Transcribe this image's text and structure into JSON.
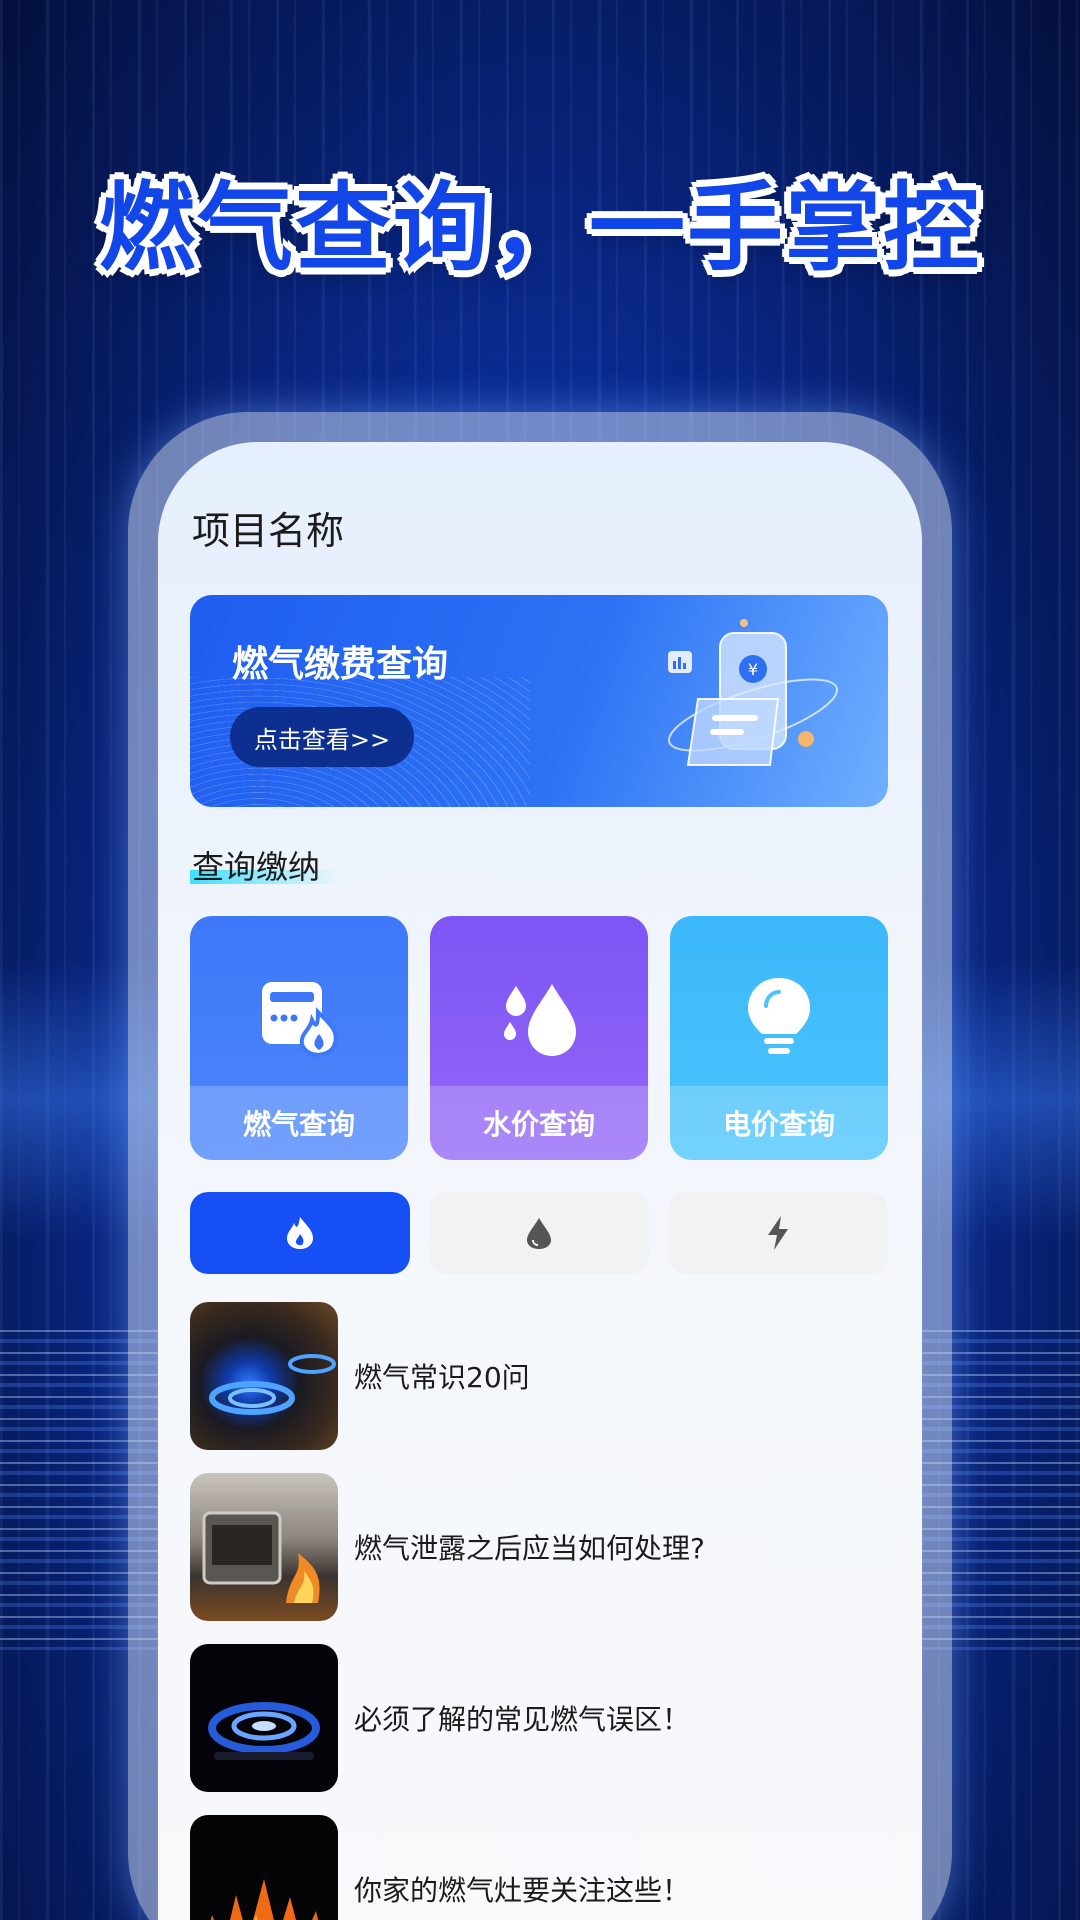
{
  "headline": "燃气查询，一手掌控",
  "app": {
    "project_name": "项目名称"
  },
  "banner": {
    "title": "燃气缴费查询",
    "button_label": "点击查看>>"
  },
  "section": {
    "title": "查询缴纳"
  },
  "tiles": [
    {
      "label": "燃气查询",
      "icon": "gas-meter-icon"
    },
    {
      "label": "水价查询",
      "icon": "water-drops-icon"
    },
    {
      "label": "电价查询",
      "icon": "lightbulb-icon"
    }
  ],
  "tabs": [
    {
      "icon": "flame-icon",
      "selected": true
    },
    {
      "icon": "water-drop-icon",
      "selected": false
    },
    {
      "icon": "lightning-icon",
      "selected": false
    }
  ],
  "articles": [
    {
      "title": "燃气常识20问"
    },
    {
      "title": "燃气泄露之后应当如何处理?"
    },
    {
      "title": "必须了解的常见燃气误区！"
    },
    {
      "title": "你家的燃气灶要关注这些！"
    }
  ],
  "colors": {
    "primary": "#1650f5",
    "gas_tile": "#3d78f8",
    "water_tile": "#7d55f6",
    "power_tile": "#3bb8fb"
  }
}
